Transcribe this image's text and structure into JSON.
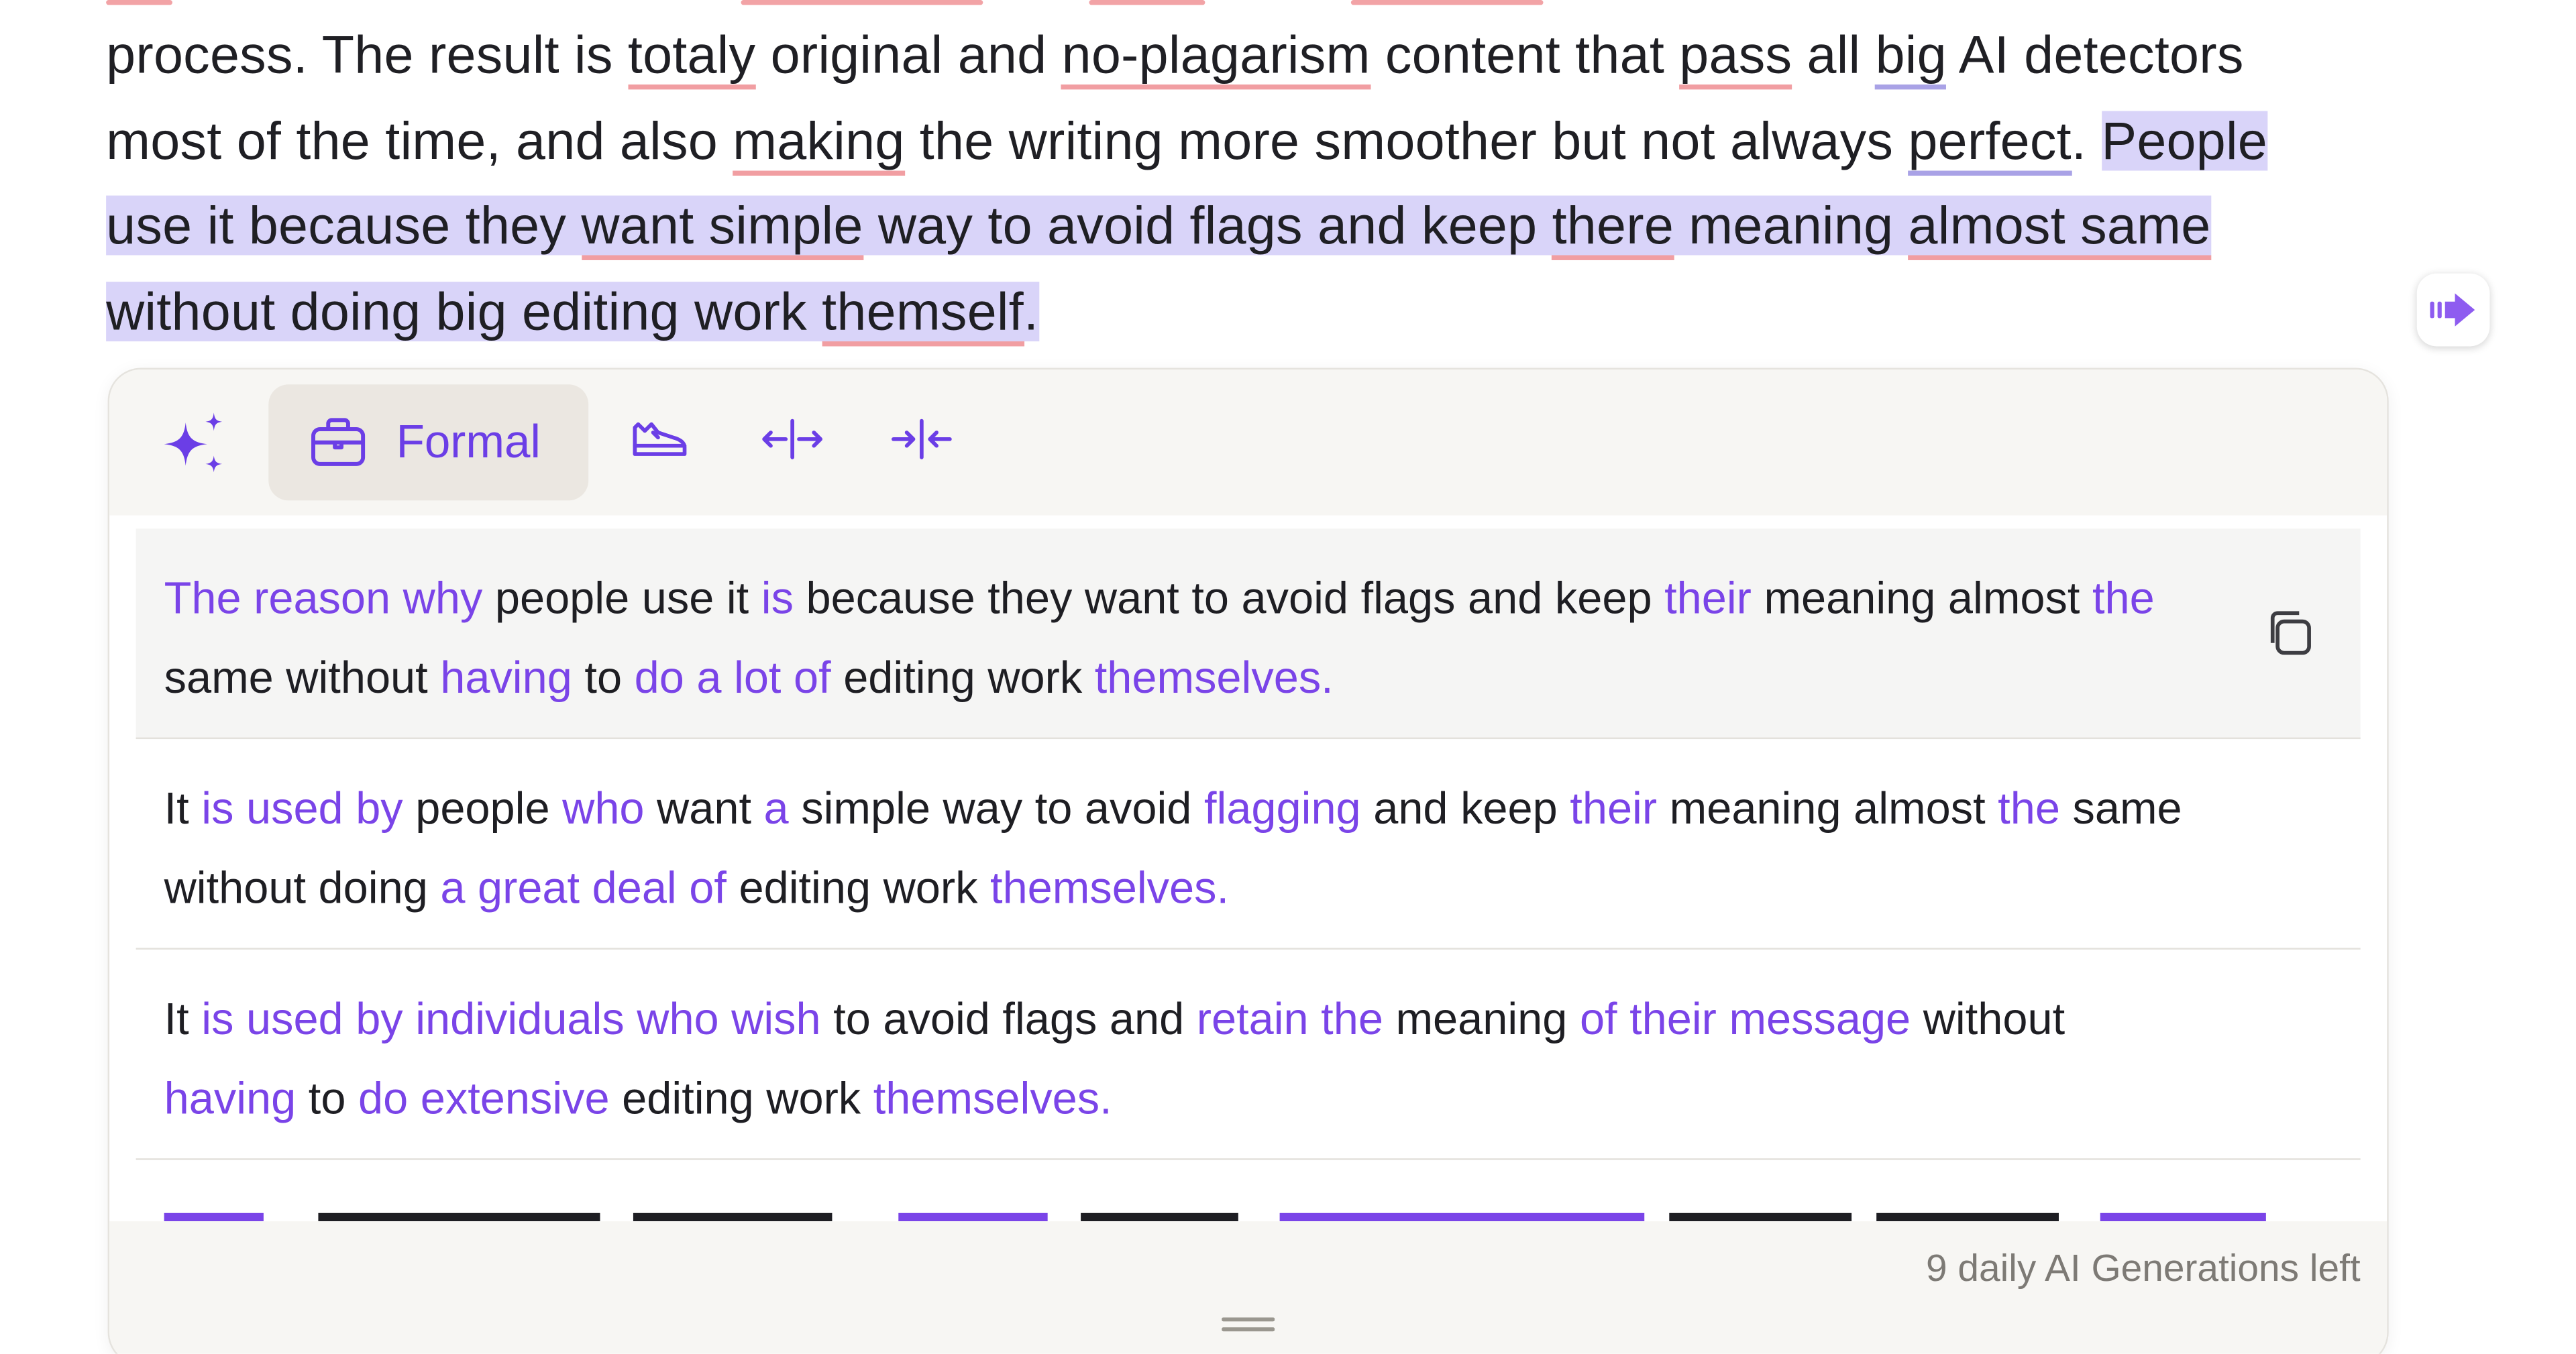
{
  "editor": {
    "line1": [
      "process. The result is ",
      "totaly",
      " original and ",
      "no-plagarism",
      " content that ",
      "pass",
      " all ",
      "big",
      " AI detectors"
    ],
    "line2": [
      "most of the time, and also ",
      "making",
      " the writing more smoother but not always ",
      "perfect",
      ". "
    ],
    "sel2": "People",
    "line3": [
      "use it because they ",
      "want simple",
      " way to avoid flags and keep ",
      "there",
      " meaning ",
      "almost same"
    ],
    "line4": [
      "without doing big editing work ",
      "themself",
      "."
    ]
  },
  "toolbar": {
    "formal_label": "Formal",
    "icons": [
      "sparkle-icon",
      "briefcase-icon",
      "casual-shoe-icon",
      "expand-icon",
      "shorten-icon"
    ]
  },
  "suggestions": [
    {
      "segments": [
        {
          "t": "The reason why",
          "c": true
        },
        {
          "t": " people use it "
        },
        {
          "t": "is",
          "c": true
        },
        {
          "t": " because they want to avoid flags and keep "
        },
        {
          "t": "their",
          "c": true
        },
        {
          "t": " meaning almost "
        },
        {
          "t": "the",
          "c": true
        },
        {
          "t": " same without "
        },
        {
          "t": "having",
          "c": true
        },
        {
          "t": " to "
        },
        {
          "t": "do a lot of",
          "c": true
        },
        {
          "t": " editing work "
        },
        {
          "t": "themselves.",
          "c": true
        }
      ]
    },
    {
      "segments": [
        {
          "t": "It "
        },
        {
          "t": "is used by",
          "c": true
        },
        {
          "t": " people "
        },
        {
          "t": "who",
          "c": true
        },
        {
          "t": " want "
        },
        {
          "t": "a",
          "c": true
        },
        {
          "t": " simple way to avoid "
        },
        {
          "t": "flagging",
          "c": true
        },
        {
          "t": " and keep "
        },
        {
          "t": "their",
          "c": true
        },
        {
          "t": " meaning almost "
        },
        {
          "t": "the",
          "c": true
        },
        {
          "t": " same without doing "
        },
        {
          "t": "a great deal of",
          "c": true
        },
        {
          "t": " editing work "
        },
        {
          "t": "themselves.",
          "c": true
        }
      ]
    },
    {
      "segments": [
        {
          "t": "It "
        },
        {
          "t": "is used by individuals who wish",
          "c": true
        },
        {
          "t": " to avoid flags and "
        },
        {
          "t": "retain the",
          "c": true
        },
        {
          "t": " meaning "
        },
        {
          "t": "of their message",
          "c": true
        },
        {
          "t": " without "
        },
        {
          "t": "having",
          "c": true
        },
        {
          "t": " to "
        },
        {
          "t": "do extensive",
          "c": true
        },
        {
          "t": " editing work "
        },
        {
          "t": "themselves.",
          "c": true
        }
      ]
    }
  ],
  "footer": {
    "credits": "9 daily AI Generations left"
  },
  "colors": {
    "accent": "#7a44e8",
    "selection": "#d9d4f9",
    "spelling_underline": "#f19ea2"
  }
}
